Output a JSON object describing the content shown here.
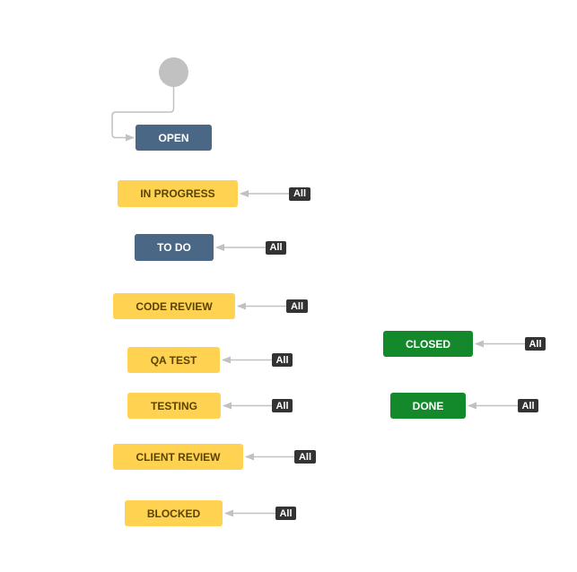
{
  "diagram": {
    "type": "workflow",
    "start_node": "start",
    "colors": {
      "todo": "#4a6785",
      "in_progress": "#ffd351",
      "done": "#14892c",
      "badge": "#333333",
      "connector": "#c1c1c1"
    },
    "statuses": [
      {
        "id": "open",
        "label": "OPEN",
        "category": "todo",
        "global_transition": null
      },
      {
        "id": "in-progress",
        "label": "IN PROGRESS",
        "category": "in_progress",
        "global_transition": "All"
      },
      {
        "id": "to-do",
        "label": "TO DO",
        "category": "todo",
        "global_transition": "All"
      },
      {
        "id": "code-review",
        "label": "CODE REVIEW",
        "category": "in_progress",
        "global_transition": "All"
      },
      {
        "id": "qa-test",
        "label": "QA TEST",
        "category": "in_progress",
        "global_transition": "All"
      },
      {
        "id": "testing",
        "label": "TESTING",
        "category": "in_progress",
        "global_transition": "All"
      },
      {
        "id": "client-review",
        "label": "CLIENT REVIEW",
        "category": "in_progress",
        "global_transition": "All"
      },
      {
        "id": "blocked",
        "label": "BLOCKED",
        "category": "in_progress",
        "global_transition": "All"
      },
      {
        "id": "closed",
        "label": "CLOSED",
        "category": "done",
        "global_transition": "All"
      },
      {
        "id": "done",
        "label": "DONE",
        "category": "done",
        "global_transition": "All"
      }
    ],
    "edges": [
      {
        "from": "start",
        "to": "open"
      }
    ]
  }
}
